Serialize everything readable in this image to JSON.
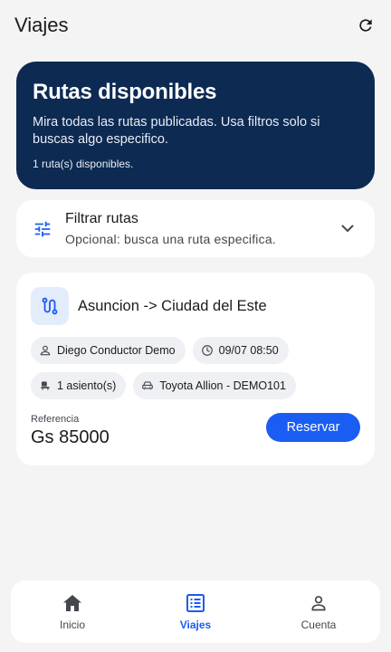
{
  "appbar": {
    "title": "Viajes"
  },
  "hero": {
    "title": "Rutas disponibles",
    "subtitle": "Mira todas las rutas publicadas. Usa filtros solo si buscas algo especifico.",
    "count": "1 ruta(s) disponibles."
  },
  "filter": {
    "title": "Filtrar rutas",
    "subtitle": "Opcional: busca una ruta especifica."
  },
  "route": {
    "title": "Asuncion -> Ciudad del Este",
    "driver": "Diego Conductor Demo",
    "datetime": "09/07 08:50",
    "seats": "1 asiento(s)",
    "vehicle": "Toyota Allion - DEMO101",
    "price_label": "Referencia",
    "price": "Gs 85000",
    "reserve_label": "Reservar"
  },
  "nav": {
    "items": [
      {
        "label": "Inicio",
        "icon": "home-icon",
        "active": false
      },
      {
        "label": "Viajes",
        "icon": "list-icon",
        "active": true
      },
      {
        "label": "Cuenta",
        "icon": "person-icon",
        "active": false
      }
    ]
  },
  "colors": {
    "hero_bg": "#0d2a52",
    "accent": "#1a5df2",
    "background": "#f4f4f5"
  }
}
